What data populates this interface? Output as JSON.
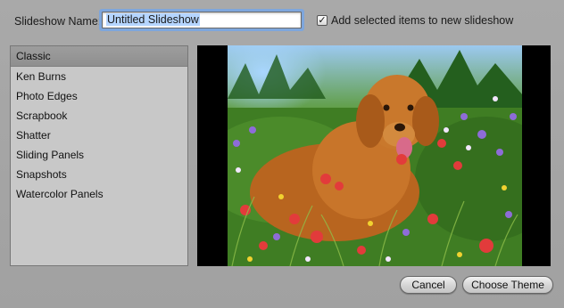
{
  "dialog": {
    "name_label": "Slideshow Name:",
    "name_value": "Untitled Slideshow",
    "add_selected_label": "Add selected items to new slideshow",
    "add_selected_checked": true
  },
  "themes": {
    "selected_index": 0,
    "items": [
      {
        "label": "Classic"
      },
      {
        "label": "Ken Burns"
      },
      {
        "label": "Photo Edges"
      },
      {
        "label": "Scrapbook"
      },
      {
        "label": "Shatter"
      },
      {
        "label": "Sliding Panels"
      },
      {
        "label": "Snapshots"
      },
      {
        "label": "Watercolor Panels"
      }
    ]
  },
  "buttons": {
    "cancel": "Cancel",
    "choose": "Choose Theme"
  },
  "icons": {
    "checkbox_check": "✓"
  },
  "colors": {
    "dialog_bg": "#a5a5a5",
    "list_bg": "#c8c8c8",
    "selected_row": "#969696",
    "focus_ring": "#7ea6dc",
    "preview_bg": "#000000"
  }
}
